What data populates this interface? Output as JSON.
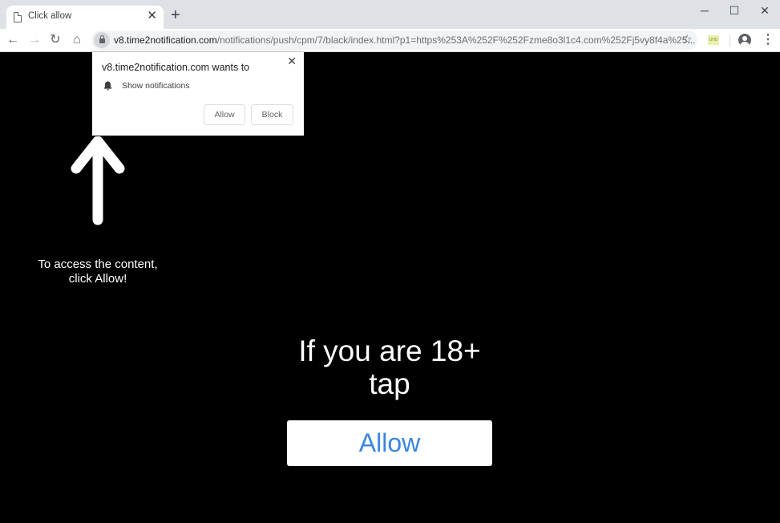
{
  "browser": {
    "tab": {
      "title": "Click allow",
      "icon": "page-icon"
    },
    "window_controls": {
      "minimize": "─",
      "maximize": "☐",
      "close": "✕"
    },
    "nav": {
      "back": "←",
      "forward": "→",
      "reload": "↻",
      "home": "⌂"
    },
    "url": {
      "host": "v8.time2notification.com",
      "path": "/notifications/push/cpm/7/black/index.html?p1=https%253A%252F%252Fzme8o3l1c4.com%252Fj5vy8f4a%25..."
    },
    "extension_label": "UHD"
  },
  "permission_popup": {
    "title": "v8.time2notification.com wants to",
    "permission": "Show notifications",
    "allow_label": "Allow",
    "block_label": "Block",
    "close_glyph": "✕"
  },
  "page": {
    "hint_line1": "To access the content,",
    "hint_line2": "click Allow!",
    "headline_line1": "If you are 18+",
    "headline_line2": "tap",
    "cta_label": "Allow",
    "cta_color": "#3a86e0",
    "background": "#000000"
  }
}
